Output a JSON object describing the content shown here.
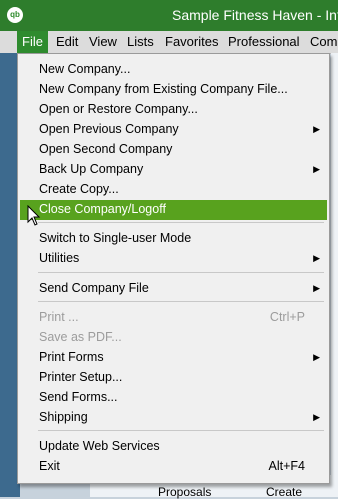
{
  "window": {
    "title": "Sample Fitness Haven - Intu",
    "logo": "qb"
  },
  "menubar": {
    "file": "File",
    "edit": "Edit",
    "view": "View",
    "lists": "Lists",
    "favorites": "Favorites",
    "professional": "Professional",
    "company": "Com"
  },
  "file_menu": {
    "items": [
      {
        "label": "New Company...",
        "shortcut": ""
      },
      {
        "label": "New Company from Existing Company File...",
        "shortcut": ""
      },
      {
        "label": "Open or Restore Company...",
        "shortcut": ""
      },
      {
        "label": "Open Previous Company",
        "shortcut": ""
      },
      {
        "label": "Open Second Company",
        "shortcut": ""
      },
      {
        "label": "Back Up Company",
        "shortcut": ""
      },
      {
        "label": "Create Copy...",
        "shortcut": ""
      },
      {
        "label": "Close Company/Logoff",
        "shortcut": ""
      },
      {
        "label": "Switch to Single-user Mode",
        "shortcut": ""
      },
      {
        "label": "Utilities",
        "shortcut": ""
      },
      {
        "label": "Send Company File",
        "shortcut": ""
      },
      {
        "label": "Print ...",
        "shortcut": "Ctrl+P"
      },
      {
        "label": "Save as PDF...",
        "shortcut": ""
      },
      {
        "label": "Print Forms",
        "shortcut": ""
      },
      {
        "label": "Printer Setup...",
        "shortcut": ""
      },
      {
        "label": "Send Forms...",
        "shortcut": ""
      },
      {
        "label": "Shipping",
        "shortcut": ""
      },
      {
        "label": "Update Web Services",
        "shortcut": ""
      },
      {
        "label": "Exit",
        "shortcut": "Alt+F4"
      }
    ]
  },
  "background": {
    "proposals": "Proposals",
    "create": "Create"
  },
  "colors": {
    "titlebar": "#2e7d2c",
    "highlight": "#58a21e"
  }
}
